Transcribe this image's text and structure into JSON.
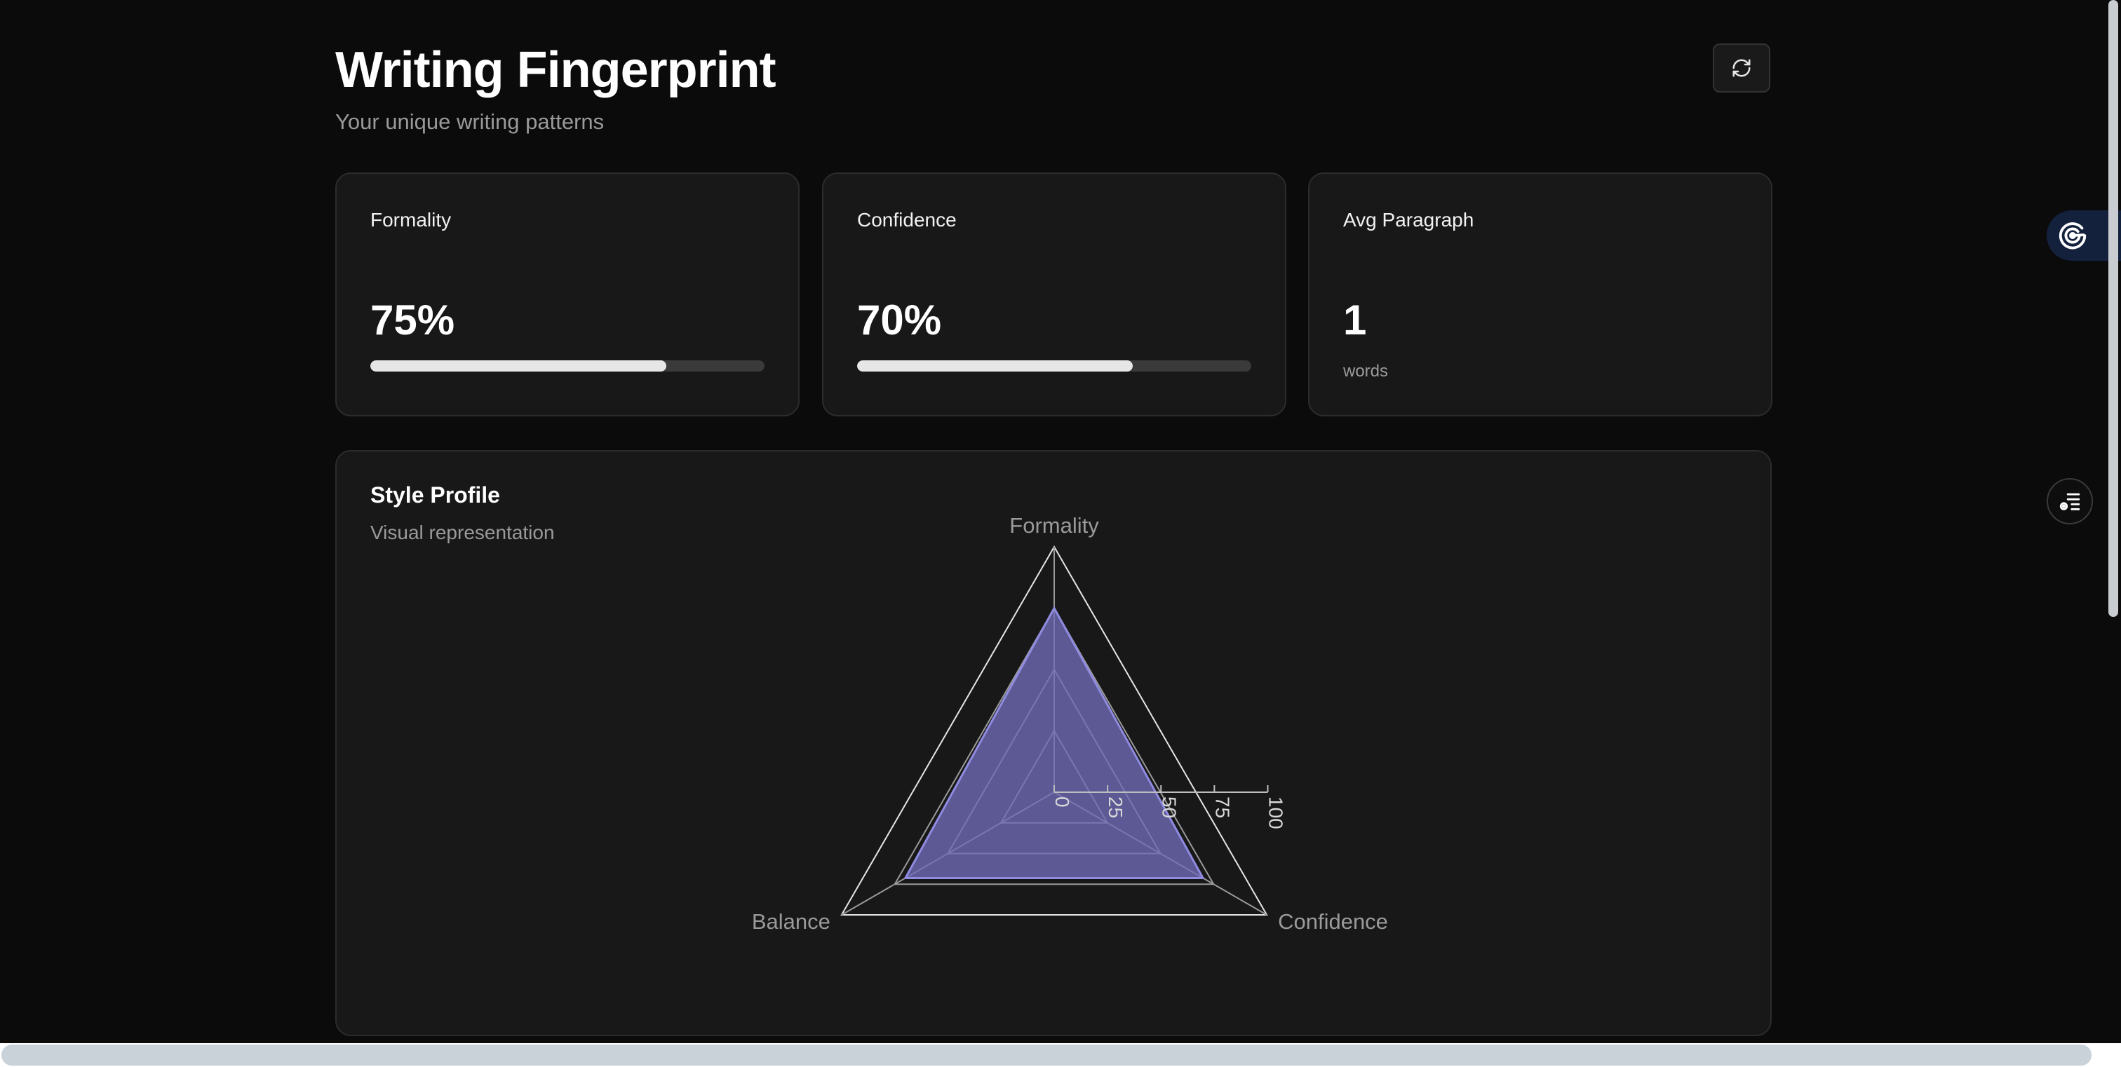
{
  "header": {
    "title": "Writing Fingerprint",
    "subtitle": "Your unique writing patterns",
    "refresh_icon": "refresh-icon"
  },
  "stats": [
    {
      "label": "Formality",
      "value": "75%",
      "progress": 0.75
    },
    {
      "label": "Confidence",
      "value": "70%",
      "progress": 0.7
    },
    {
      "label": "Avg Paragraph",
      "value": "1",
      "unit": "words"
    }
  ],
  "style_profile": {
    "title": "Style Profile",
    "subtitle": "Visual representation"
  },
  "chart_data": {
    "type": "radar",
    "axes": [
      "Formality",
      "Confidence",
      "Balance"
    ],
    "values": [
      75,
      70,
      70
    ],
    "rlim": [
      0,
      100
    ],
    "ticks": [
      "0",
      "25",
      "50",
      "75",
      "100"
    ],
    "grid": true,
    "fill_color": "#6f6bb8"
  },
  "side": {
    "tab_icon": "target-icon",
    "button_icon": "list-settings-icon"
  },
  "colors": {
    "background": "#0b0b0b",
    "card": "#181818",
    "accent": "#6f6bb8"
  }
}
